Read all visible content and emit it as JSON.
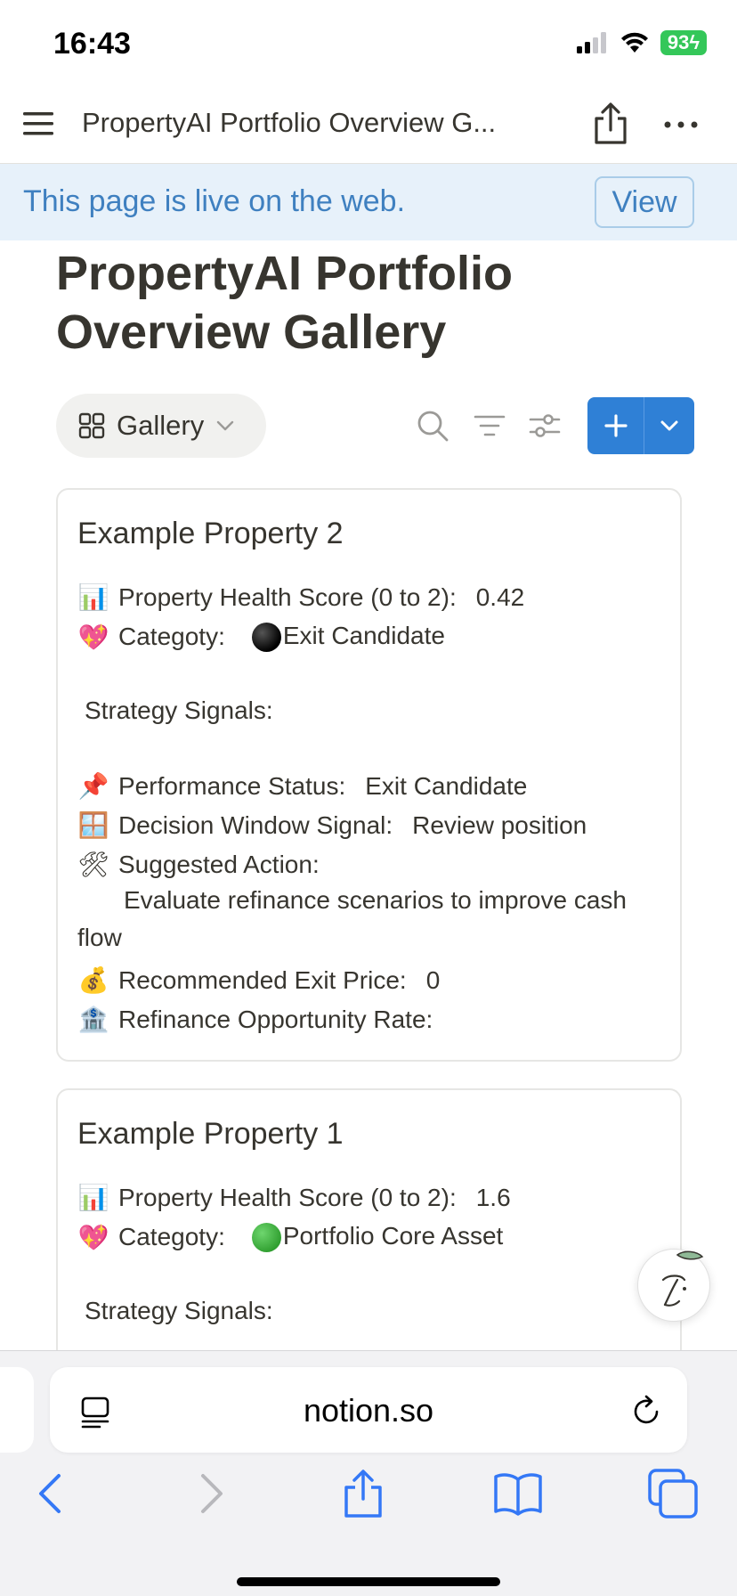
{
  "status_bar": {
    "time": "16:43",
    "battery": "93"
  },
  "top_bar": {
    "title": "PropertyAI Portfolio Overview G..."
  },
  "banner": {
    "text": "This page is live on the web.",
    "view_label": "View"
  },
  "page": {
    "title_line1": "PropertyAI Portfolio",
    "title_line2": "Overview Gallery"
  },
  "view_bar": {
    "view_label": "Gallery"
  },
  "cards": [
    {
      "title": "Example Property 2",
      "health_label": "Property Health Score (0 to 2):",
      "health_value": "0.42",
      "category_label": "Categoty:",
      "category_value": "Exit Candidate",
      "category_color": "#000000",
      "signals_label": "Strategy Signals:",
      "performance_label": "Performance Status:",
      "performance_value": "Exit Candidate",
      "decision_label": "Decision Window Signal:",
      "decision_value": "Review position",
      "action_label": "Suggested Action:",
      "action_value_line1": "Evaluate refinance scenarios to improve cash",
      "action_value_line2": "flow",
      "exit_label": "Recommended Exit Price:",
      "exit_value": "0",
      "refi_label": "Refinance Opportunity Rate:"
    },
    {
      "title": "Example Property 1",
      "health_label": "Property Health Score (0 to 2):",
      "health_value": "1.6",
      "category_label": "Categoty:",
      "category_value": "Portfolio Core Asset",
      "category_color": "#2e9d2e",
      "signals_label": "Strategy Signals:"
    }
  ],
  "icons": {
    "chart": "📊",
    "heart": "💖",
    "pin": "📌",
    "window": "🪟",
    "tools": "🛠",
    "money_bag": "💰",
    "bank": "🏦"
  },
  "safari": {
    "url": "notion.so"
  }
}
